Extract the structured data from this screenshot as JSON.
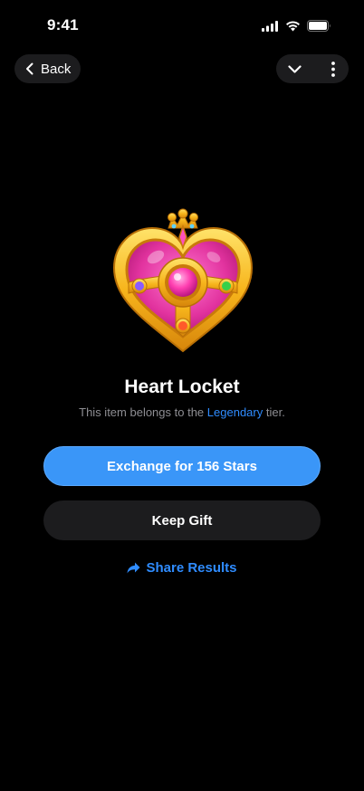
{
  "status_bar": {
    "time": "9:41"
  },
  "nav": {
    "back_label": "Back",
    "icons": {
      "dropdown": "chevron-down-icon",
      "more": "more-vertical-icon"
    }
  },
  "item": {
    "name": "Heart Locket",
    "image": "heart-locket-icon",
    "subtitle_prefix": "This item belongs to the",
    "tier": "Legendary",
    "subtitle_suffix": "tier."
  },
  "actions": {
    "exchange_label": "Exchange for 156 Stars",
    "keep_label": "Keep Gift",
    "share_label": "Share Results"
  },
  "colors": {
    "accent": "#2f8cff",
    "primary_button": "#3a96f8",
    "secondary_button": "#1c1c1e",
    "background": "#000000"
  }
}
